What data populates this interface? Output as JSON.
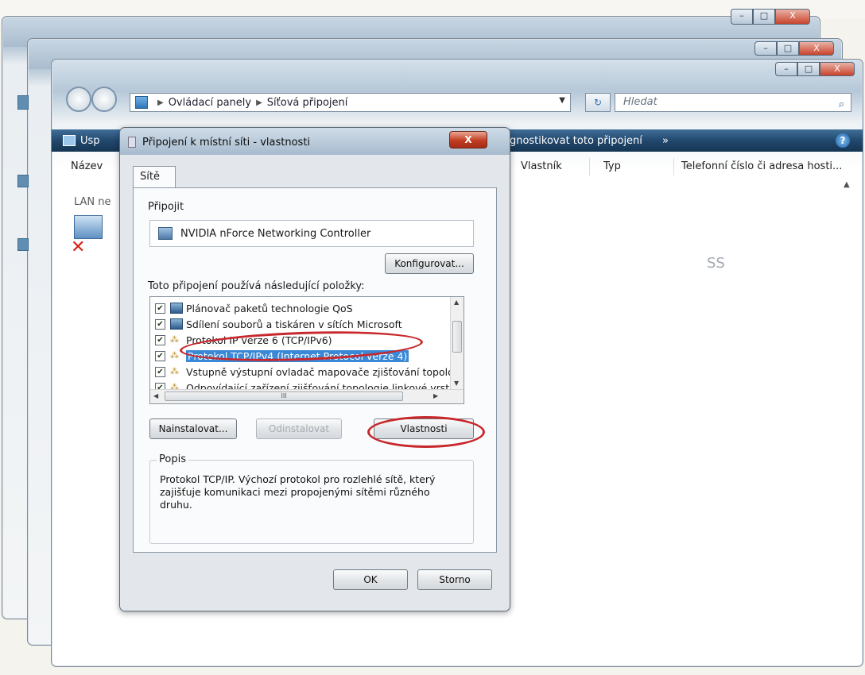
{
  "explorer": {
    "address_parts": [
      "Ovládací panely",
      "Síťová připojení"
    ],
    "search_placeholder": "Hledat",
    "cmd_left": "Usp",
    "cmd_right": "agnostikovat toto připojení",
    "cmd_more": "»",
    "columns": [
      "Název",
      "Vlastník",
      "Typ",
      "Telefonní číslo či adresa hosti..."
    ],
    "lan_label": "LAN ne",
    "faded_text": "SS"
  },
  "dialog": {
    "title": "Připojení k místní síti - vlastnosti",
    "close": "X",
    "tab": "Sítě",
    "connect_label": "Připojit",
    "adapter": "NVIDIA nForce Networking Controller",
    "configure": "Konfigurovat...",
    "items_label": "Toto připojení používá následující položky:",
    "items": [
      {
        "label": "Plánovač paketů technologie QoS",
        "checked": "✔"
      },
      {
        "label": "Sdílení souborů a tiskáren v sítích Microsoft",
        "checked": "✔"
      },
      {
        "label": "Protokol IP verze 6 (TCP/IPv6)",
        "checked": "✔"
      },
      {
        "label": "Protokol TCP/IPv4 (Internet Protocol verze 4)",
        "checked": "✔"
      },
      {
        "label": "Vstupně výstupní ovladač mapovače zjišťování topolo",
        "checked": "✔"
      },
      {
        "label": "Odpovídající zařízení zjišťování topologie linkové vrst",
        "checked": "✔"
      }
    ],
    "scroll_mid": "III",
    "install": "Nainstalovat...",
    "uninstall": "Odinstalovat",
    "properties": "Vlastnosti",
    "desc_title": "Popis",
    "desc": "Protokol TCP/IP. Výchozí protokol pro rozlehlé sítě, který zajišťuje komunikaci mezi propojenými sítěmi různého druhu.",
    "ok": "OK",
    "cancel": "Storno"
  },
  "icons": {
    "minimize": "–",
    "maximize": "□",
    "close_win": "X",
    "refresh": "↻",
    "search": "⌕",
    "help": "?"
  },
  "colors": {
    "command_bar": "#22486d",
    "selection": "#3a88d6",
    "highlight_marker": "#c8282b"
  }
}
